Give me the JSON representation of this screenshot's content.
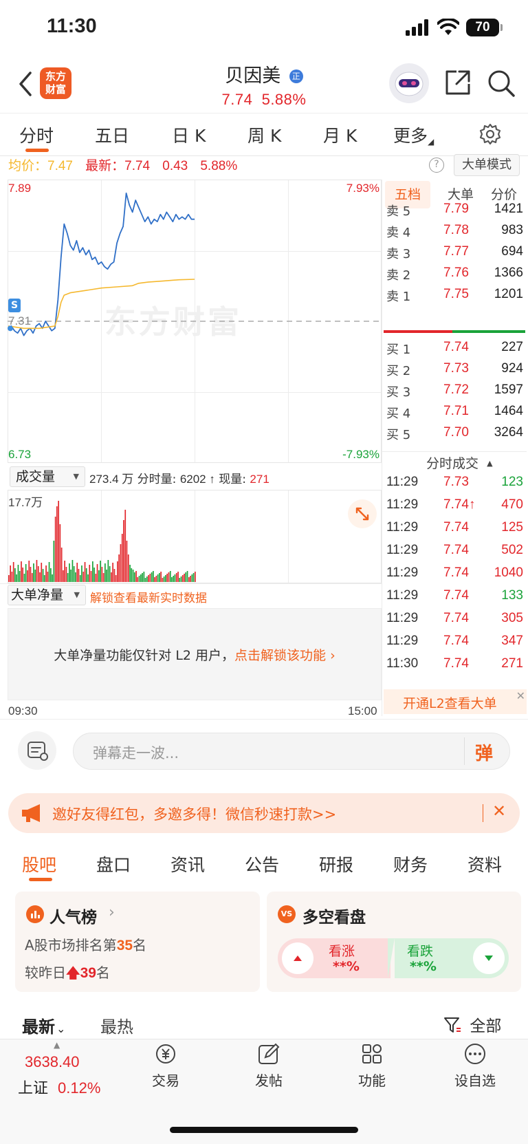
{
  "status_bar": {
    "time": "11:30",
    "battery": "70"
  },
  "header": {
    "stock_name": "贝因美",
    "name_badge": "正",
    "price": "7.74",
    "change_pct": "5.88%",
    "logo_text": "东方财富"
  },
  "tabs": [
    "分时",
    "五日",
    "日 K",
    "周 K",
    "月 K",
    "更多"
  ],
  "chart_info": {
    "avg_label": "均价：",
    "avg_value": "7.47",
    "latest_label": "最新：",
    "latest_value": "7.74",
    "change_abs": "0.43",
    "change_pct": "5.88%",
    "mode_button": "大单模式",
    "help": "?"
  },
  "chart_data": {
    "type": "line",
    "title": "",
    "ylim": [
      6.73,
      7.89
    ],
    "prev_close": 7.31,
    "y_labels": {
      "top": "7.89",
      "mid": "7.31",
      "bottom": "6.73",
      "top_pct": "7.93%",
      "bottom_pct": "-7.93%"
    },
    "x_labels": [
      "09:30",
      "15:00"
    ],
    "watermark": "东方财富",
    "marker": "S",
    "series": [
      {
        "name": "",
        "color": "#2f6fc7",
        "x_minutes": [
          0,
          2,
          4,
          6,
          8,
          10,
          12,
          14,
          16,
          18,
          20,
          22,
          24,
          26,
          28,
          30,
          32,
          34,
          36,
          38,
          40,
          42,
          44,
          46,
          48,
          50,
          52,
          54,
          56,
          58,
          60,
          62,
          64,
          66,
          68,
          70,
          72,
          74,
          76,
          78,
          80,
          82,
          84,
          86,
          88,
          90,
          92,
          94,
          96,
          98,
          100,
          102,
          104,
          106,
          108,
          110,
          112,
          114,
          116,
          118,
          120
        ],
        "values": [
          7.28,
          7.29,
          7.27,
          7.26,
          7.28,
          7.25,
          7.27,
          7.28,
          7.26,
          7.29,
          7.3,
          7.28,
          7.31,
          7.29,
          7.27,
          7.28,
          7.4,
          7.58,
          7.72,
          7.68,
          7.63,
          7.61,
          7.65,
          7.6,
          7.62,
          7.59,
          7.61,
          7.57,
          7.58,
          7.55,
          7.56,
          7.54,
          7.53,
          7.55,
          7.56,
          7.64,
          7.68,
          7.71,
          7.85,
          7.8,
          7.77,
          7.82,
          7.79,
          7.76,
          7.73,
          7.75,
          7.72,
          7.74,
          7.73,
          7.76,
          7.74,
          7.77,
          7.75,
          7.73,
          7.76,
          7.74,
          7.75,
          7.74,
          7.76,
          7.74,
          7.74
        ]
      },
      {
        "name": "",
        "color": "#f5b82e",
        "x_minutes": [
          0,
          10,
          20,
          30,
          32,
          34,
          36,
          40,
          50,
          60,
          70,
          80,
          84,
          90,
          100,
          110,
          120
        ],
        "values": [
          7.29,
          7.28,
          7.28,
          7.29,
          7.33,
          7.39,
          7.42,
          7.43,
          7.44,
          7.45,
          7.455,
          7.46,
          7.47,
          7.475,
          7.48,
          7.485,
          7.487
        ]
      }
    ]
  },
  "volume": {
    "dropdown_label": "成交量",
    "total": "273.4 万",
    "minute_label": "分时量: ",
    "minute_value": "6202 ↑",
    "current_label": "现量: ",
    "current_value": "271",
    "max_label": "17.7万"
  },
  "big_order": {
    "dropdown_label": "大单净量",
    "unlock_link": "解锁查看最新实时数据",
    "notice_text": "大单净量功能仅针对 L2 用户，",
    "notice_link": "点击解锁该功能"
  },
  "order_book": {
    "tabs": [
      "五档",
      "大单",
      "分价"
    ],
    "asks": [
      {
        "label": "卖 5",
        "price": "7.79",
        "volume": "1421"
      },
      {
        "label": "卖 4",
        "price": "7.78",
        "volume": "983"
      },
      {
        "label": "卖 3",
        "price": "7.77",
        "volume": "694"
      },
      {
        "label": "卖 2",
        "price": "7.76",
        "volume": "1366"
      },
      {
        "label": "卖 1",
        "price": "7.75",
        "volume": "1201"
      }
    ],
    "bids": [
      {
        "label": "买 1",
        "price": "7.74",
        "volume": "227"
      },
      {
        "label": "买 2",
        "price": "7.73",
        "volume": "924"
      },
      {
        "label": "买 3",
        "price": "7.72",
        "volume": "1597"
      },
      {
        "label": "买 4",
        "price": "7.71",
        "volume": "1464"
      },
      {
        "label": "买 5",
        "price": "7.70",
        "volume": "3264"
      }
    ]
  },
  "trades": {
    "title": "分时成交",
    "rows": [
      {
        "time": "11:29",
        "price": "7.73",
        "volume": "123",
        "side": "green"
      },
      {
        "time": "11:29",
        "price": "7.74↑",
        "volume": "470",
        "side": "red"
      },
      {
        "time": "11:29",
        "price": "7.74",
        "volume": "125",
        "side": "red"
      },
      {
        "time": "11:29",
        "price": "7.74",
        "volume": "502",
        "side": "red"
      },
      {
        "time": "11:29",
        "price": "7.74",
        "volume": "1040",
        "side": "red"
      },
      {
        "time": "11:29",
        "price": "7.74",
        "volume": "133",
        "side": "green"
      },
      {
        "time": "11:29",
        "price": "7.74",
        "volume": "305",
        "side": "red"
      },
      {
        "time": "11:29",
        "price": "7.74",
        "volume": "347",
        "side": "red"
      },
      {
        "time": "11:30",
        "price": "7.74",
        "volume": "271",
        "side": "red"
      }
    ],
    "l2_banner": "开通L2查看大单"
  },
  "danmaku": {
    "placeholder": "弹幕走一波...",
    "send_label": "弹"
  },
  "promo": {
    "text": "邀好友得红包，多邀多得！微信秒速打款>>"
  },
  "content_tabs": [
    "股吧",
    "盘口",
    "资讯",
    "公告",
    "研报",
    "财务",
    "资料"
  ],
  "popularity": {
    "title": "人气榜",
    "rank_prefix": "A股市场排名第",
    "rank": "35",
    "rank_suffix": "名",
    "change_prefix": "较昨日",
    "change_value": "39",
    "change_suffix": "名"
  },
  "sentiment": {
    "title": "多空看盘",
    "bull_label": "看涨",
    "bull_value": "**%",
    "bear_label": "看跌",
    "bear_value": "**%"
  },
  "feed_filter": {
    "latest": "最新",
    "hot": "最热",
    "all": "全部"
  },
  "bottom_nav": {
    "index_value": "3638.40",
    "index_name": "上证",
    "index_change": "0.12%",
    "items": [
      "交易",
      "发帖",
      "功能",
      "设自选"
    ]
  }
}
